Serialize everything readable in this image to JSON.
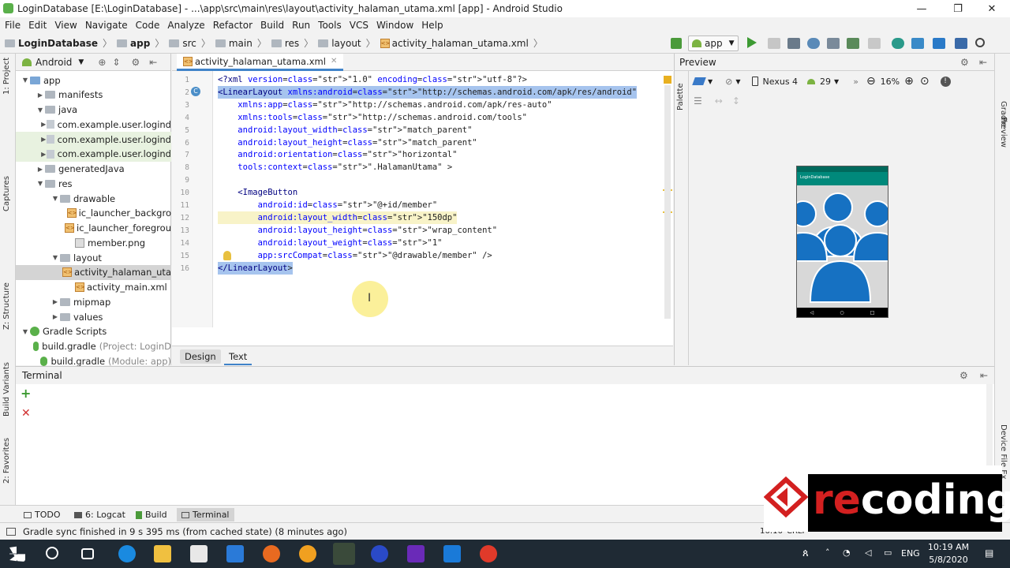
{
  "window": {
    "title": "LoginDatabase [E:\\LoginDatabase] - ...\\app\\src\\main\\res\\layout\\activity_halaman_utama.xml [app] - Android Studio",
    "min": "—",
    "max": "❐",
    "close": "✕"
  },
  "menu": [
    "File",
    "Edit",
    "View",
    "Navigate",
    "Code",
    "Analyze",
    "Refactor",
    "Build",
    "Run",
    "Tools",
    "VCS",
    "Window",
    "Help"
  ],
  "breadcrumb": [
    "LoginDatabase",
    "app",
    "src",
    "main",
    "res",
    "layout",
    "activity_halaman_utama.xml"
  ],
  "run_config": "app",
  "device": "Nexus 4",
  "api": "29",
  "zoom": "16%",
  "project": {
    "view": "Android",
    "items": [
      {
        "label": "app",
        "depth": 0,
        "arrow": "▼",
        "icon": "folder-blue"
      },
      {
        "label": "manifests",
        "depth": 1,
        "arrow": "▶",
        "icon": "folder"
      },
      {
        "label": "java",
        "depth": 1,
        "arrow": "▼",
        "icon": "folder"
      },
      {
        "label": "com.example.user.logind",
        "depth": 2,
        "arrow": "▶",
        "icon": "package"
      },
      {
        "label": "com.example.user.logind",
        "depth": 2,
        "arrow": "▶",
        "icon": "package"
      },
      {
        "label": "com.example.user.logind",
        "depth": 2,
        "arrow": "▶",
        "icon": "package"
      },
      {
        "label": "generatedJava",
        "depth": 1,
        "arrow": "▶",
        "icon": "folder"
      },
      {
        "label": "res",
        "depth": 1,
        "arrow": "▼",
        "icon": "folder"
      },
      {
        "label": "drawable",
        "depth": 2,
        "arrow": "▼",
        "icon": "folder"
      },
      {
        "label": "ic_launcher_backgro",
        "depth": 3,
        "arrow": "",
        "icon": "xml"
      },
      {
        "label": "ic_launcher_foregrou",
        "depth": 3,
        "arrow": "",
        "icon": "xml"
      },
      {
        "label": "member.png",
        "depth": 3,
        "arrow": "",
        "icon": "png"
      },
      {
        "label": "layout",
        "depth": 2,
        "arrow": "▼",
        "icon": "folder"
      },
      {
        "label": "activity_halaman_uta",
        "depth": 3,
        "arrow": "",
        "icon": "xml"
      },
      {
        "label": "activity_main.xml",
        "depth": 3,
        "arrow": "",
        "icon": "xml"
      },
      {
        "label": "mipmap",
        "depth": 2,
        "arrow": "▶",
        "icon": "folder"
      },
      {
        "label": "values",
        "depth": 2,
        "arrow": "▶",
        "icon": "folder"
      },
      {
        "label": "Gradle Scripts",
        "depth": 0,
        "arrow": "▼",
        "icon": "gradle"
      },
      {
        "label": "build.gradle",
        "hint": "(Project: LoginD",
        "depth": 1,
        "arrow": "",
        "icon": "gradle"
      },
      {
        "label": "build.gradle",
        "hint": "(Module: app)",
        "depth": 1,
        "arrow": "",
        "icon": "gradle"
      }
    ]
  },
  "editor": {
    "tab": "activity_halaman_utama.xml",
    "lines": [
      {
        "n": "1",
        "html": "<span class='tag'>&lt;?xml </span><span class='attr'>version=</span><span class='str'>\"1.0\"</span> <span class='attr'>encoding=</span><span class='str'>\"utf-8\"</span><span class='tag'>?&gt;</span>",
        "text": "<?xml version=\"1.0\" encoding=\"utf-8\"?>"
      },
      {
        "n": "2",
        "text": "<LinearLayout xmlns:android=\"http://schemas.android.com/apk/res/android\""
      },
      {
        "n": "3",
        "text": "    xmlns:app=\"http://schemas.android.com/apk/res-auto\""
      },
      {
        "n": "4",
        "text": "    xmlns:tools=\"http://schemas.android.com/tools\""
      },
      {
        "n": "5",
        "text": "    android:layout_width=\"match_parent\""
      },
      {
        "n": "6",
        "text": "    android:layout_height=\"match_parent\""
      },
      {
        "n": "7",
        "text": "    android:orientation=\"horizontal\""
      },
      {
        "n": "8",
        "text": "    tools:context=\".HalamanUtama\" >"
      },
      {
        "n": "9",
        "text": ""
      },
      {
        "n": "10",
        "text": "    <ImageButton"
      },
      {
        "n": "11",
        "text": "        android:id=\"@+id/member\""
      },
      {
        "n": "12",
        "text": "        android:layout_width=\"150dp\""
      },
      {
        "n": "13",
        "text": "        android:layout_height=\"wrap_content\""
      },
      {
        "n": "14",
        "text": "        android:layout_weight=\"1\""
      },
      {
        "n": "15",
        "text": "        app:srcCompat=\"@drawable/member\" />"
      },
      {
        "n": "16",
        "text": "</LinearLayout>"
      }
    ],
    "design_tab": "Design",
    "text_tab": "Text"
  },
  "preview": {
    "title": "Preview",
    "app_title": "LoginDatabase",
    "palette": "Palette"
  },
  "terminal": {
    "title": "Terminal"
  },
  "bottom_tabs": [
    "TODO",
    "6: Logcat",
    "Build",
    "Terminal"
  ],
  "status": {
    "message": "Gradle sync finished in 9 s 395 ms (from cached state) (8 minutes ago)",
    "pos": "16:16",
    "crlf": "CRLF"
  },
  "side_left": [
    "1: Project",
    "Captures",
    "Z: Structure",
    "Build Variants",
    "2: Favorites"
  ],
  "side_right": [
    "Gradle",
    "Preview",
    "Device File Ex"
  ],
  "taskbar": {
    "time": "10:19 AM",
    "date": "5/8/2020",
    "lang": "ENG"
  },
  "watermark": "recoding",
  "colors": {
    "accent": "#4083c9",
    "taskbar": "#1f2a34",
    "icon_blue": "#1671c2"
  }
}
